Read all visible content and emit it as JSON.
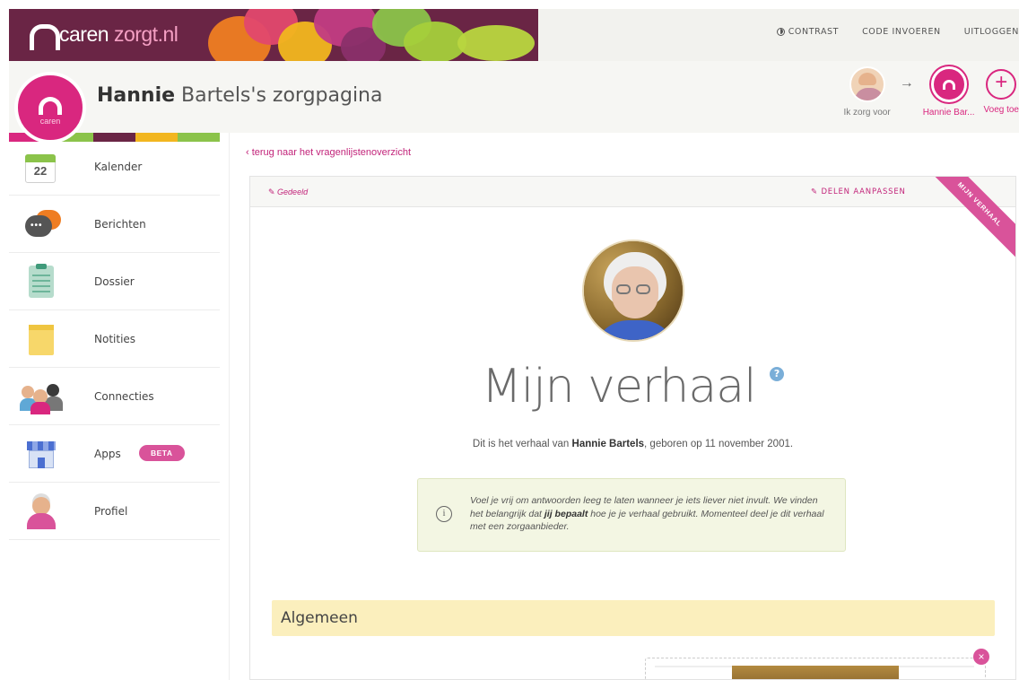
{
  "brand": {
    "name": "caren",
    "domain": "zorgt.nl",
    "avatar_label": "caren"
  },
  "toplinks": {
    "contrast": "CONTRAST",
    "code": "CODE INVOEREN",
    "logout": "UITLOGGEN"
  },
  "header": {
    "title_first": "Hannie",
    "title_rest": " Bartels's zorgpagina"
  },
  "caregiver": {
    "me_label": "Ik zorg voor",
    "current_label": "Hannie Bar...",
    "add_label": "Voeg toe",
    "arrow": "→",
    "plus": "+"
  },
  "sidebar": {
    "calendar_day": "22",
    "items": [
      {
        "label": "Kalender",
        "icon": "calendar-icon"
      },
      {
        "label": "Berichten",
        "icon": "messages-icon"
      },
      {
        "label": "Dossier",
        "icon": "clipboard-icon"
      },
      {
        "label": "Notities",
        "icon": "notes-icon"
      },
      {
        "label": "Connecties",
        "icon": "people-icon"
      },
      {
        "label": "Apps",
        "icon": "store-icon",
        "badge": "BETA"
      },
      {
        "label": "Profiel",
        "icon": "profile-icon"
      }
    ]
  },
  "main": {
    "back_link": "‹ terug naar het vragenlijstenoverzicht",
    "shared": "Gedeeld",
    "edit_share": "DELEN AANPASSEN",
    "ribbon": "MIJN VERHAAL",
    "title": "Mijn verhaal",
    "help": "?",
    "intro": {
      "prefix": "Dit is het verhaal van ",
      "name": "Hannie Bartels",
      "suffix": ", geboren op 11 november 2001."
    },
    "notice": {
      "part1": "Voel je vrij om antwoorden leeg te laten wanneer je iets liever niet invult. We vinden het belangrijk dat ",
      "bold": "jij bepaalt",
      "part2": " hoe je je verhaal gebruikt. Momenteel deel je dit verhaal met een zorgaanbieder."
    },
    "section": "Algemeen"
  },
  "colors": {
    "brand": "#6a2545",
    "accent": "#d9277f",
    "section_bg": "#fbefbd",
    "notice_bg": "#f3f6e3"
  }
}
